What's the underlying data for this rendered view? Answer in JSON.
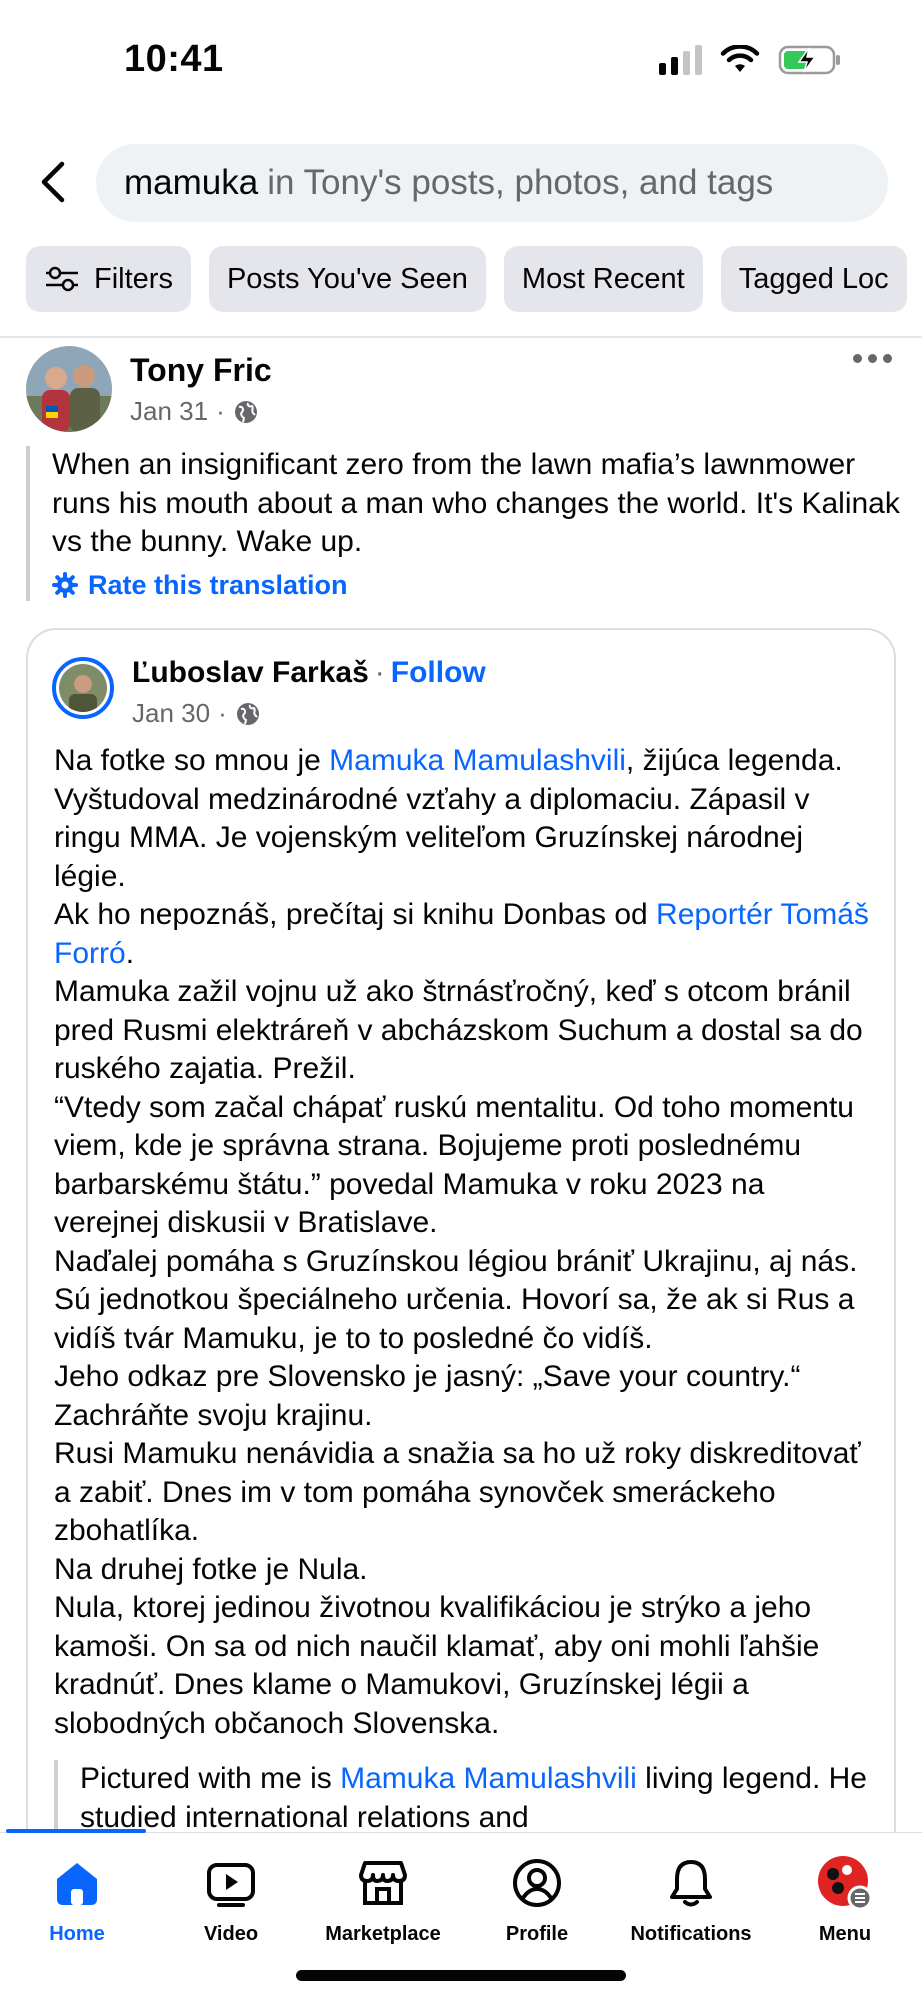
{
  "status_bar": {
    "time": "10:41"
  },
  "search": {
    "query": "mamuka",
    "hint": "in Tony's posts, photos, and tags"
  },
  "filters": {
    "items": [
      {
        "label": "Filters",
        "icon": "sliders-icon"
      },
      {
        "label": "Posts You've Seen"
      },
      {
        "label": "Most Recent"
      },
      {
        "label": "Tagged Loc"
      }
    ]
  },
  "post": {
    "author": "Tony Fric",
    "date": "Jan 31",
    "separator": "·",
    "privacy_icon": "globe-icon",
    "text": "When an insignificant zero from the lawn mafia’s lawnmower runs his mouth about a man who changes the world. It's Kalinak vs the bunny. Wake up.",
    "rate_translation": "Rate this translation"
  },
  "shared_post": {
    "author": "Ľuboslav Farkaš",
    "separator": "·",
    "follow": "Follow",
    "date": "Jan 30",
    "paragraphs": [
      {
        "before": "Na fotke so mnou je ",
        "link": "Mamuka Mamulashvili",
        "after": ", žijúca legenda. Vyštudoval medzinárodné vzťahy a diplomaciu. Zápasil v ringu MMA. Je vojenským veliteľom Gruzínskej národnej légie."
      },
      {
        "before": "Ak ho nepoznáš, prečítaj si knihu Donbas od ",
        "link": "Reportér Tomáš Forró",
        "after": "."
      },
      {
        "before": "Mamuka zažil vojnu už ako štrnásťročný, keď s otcom bránil pred Rusmi elektráreň v abcházskom Suchum a dostal sa do ruského zajatia. Prežil.",
        "link": "",
        "after": ""
      },
      {
        "before": "“Vtedy som začal chápať ruskú mentalitu. Od toho momentu viem, kde je správna strana. Bojujeme proti poslednému barbarskému štátu.” povedal Mamuka v roku 2023 na verejnej diskusii v Bratislave.",
        "link": "",
        "after": ""
      },
      {
        "before": "Naďalej pomáha s Gruzínskou légiou brániť Ukrajinu, aj nás. Sú jednotkou špeciálneho určenia. Hovorí sa, že ak si Rus a vidíš tvár Mamuku, je to to posledné čo vidíš.",
        "link": "",
        "after": ""
      },
      {
        "before": "Jeho odkaz pre Slovensko je jasný: „Save your country.“ Zachráňte svoju krajinu.",
        "link": "",
        "after": ""
      },
      {
        "before": "Rusi Mamuku nenávidia a snažia sa ho už roky diskreditovať a zabiť. Dnes im v tom pomáha synovček smeráckeho zbohatlíka.",
        "link": "",
        "after": ""
      },
      {
        "before": "Na druhej fotke je Nula.",
        "link": "",
        "after": ""
      },
      {
        "before": "Nula, ktorej jedinou životnou kvalifikáciou je strýko a jeho kamoši. On sa od nich naučil klamať, aby oni mohli ľahšie kradnúť. Dnes klame o Mamukovi, Gruzínskej légii a slobodných občanoch Slovenska.",
        "link": "",
        "after": ""
      }
    ],
    "translation": {
      "before": "Pictured with me is ",
      "link": "Mamuka Mamulashvili",
      "after": " living legend. He studied international relations and"
    }
  },
  "bottom_nav": {
    "items": [
      {
        "label": "Home",
        "icon": "home-icon",
        "active": true
      },
      {
        "label": "Video",
        "icon": "video-icon",
        "active": false
      },
      {
        "label": "Marketplace",
        "icon": "marketplace-icon",
        "active": false
      },
      {
        "label": "Profile",
        "icon": "profile-icon",
        "active": false
      },
      {
        "label": "Notifications",
        "icon": "bell-icon",
        "active": false
      },
      {
        "label": "Menu",
        "icon": "menu-avatar-icon",
        "active": false
      }
    ]
  },
  "colors": {
    "accent": "#0866ff",
    "secondary_text": "#65676b",
    "chip_bg": "#e4e6eb",
    "search_bg": "#eff2f5",
    "battery_green": "#34c759"
  }
}
